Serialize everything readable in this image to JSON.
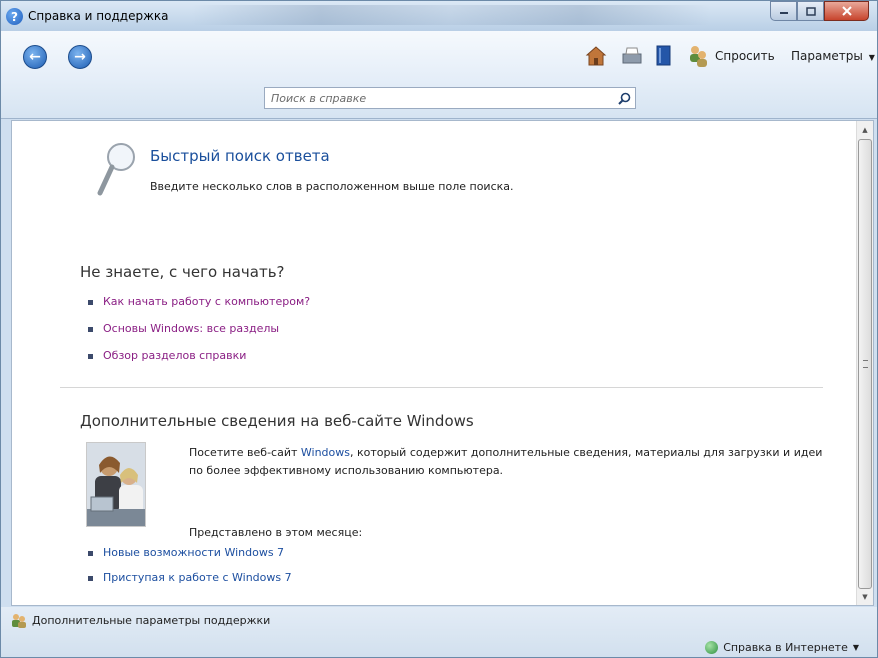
{
  "window": {
    "title": "Справка и поддержка"
  },
  "toolbar": {
    "ask_label": "Спросить",
    "params_label": "Параметры",
    "search_placeholder": "Поиск в справке"
  },
  "icons": [
    "help-icon",
    "back-icon",
    "forward-icon",
    "home-icon",
    "print-icon",
    "browse-help-icon",
    "ask-icon",
    "search-icon",
    "magnifier-icon",
    "support-options-icon",
    "globe-icon"
  ],
  "quick_search": {
    "title": "Быстрый поиск ответа",
    "description": "Введите несколько слов в расположенном выше поле поиска."
  },
  "getting_started": {
    "heading": "Не знаете, с чего начать?",
    "links": [
      {
        "label": "Как начать работу с компьютером?"
      },
      {
        "label": "Основы Windows: все разделы"
      },
      {
        "label": "Обзор разделов справки"
      }
    ]
  },
  "windows_site": {
    "heading": "Дополнительные сведения на веб-сайте Windows",
    "text_before": "Посетите веб-сайт ",
    "link": "Windows",
    "text_after": ", который содержит дополнительные сведения, материалы для загрузки и идеи по более эффективному использованию компьютера.",
    "month_label": "Представлено в этом месяце:",
    "links": [
      {
        "label": "Новые возможности Windows 7"
      },
      {
        "label": "Приступая к работе с Windows 7"
      }
    ]
  },
  "footer": {
    "more_options": "Дополнительные параметры поддержки",
    "online_help": "Справка в Интернете"
  },
  "colors": {
    "link_visited": "#8a1e84",
    "link": "#1d4fa0",
    "title_blue": "#1a4f9c"
  }
}
